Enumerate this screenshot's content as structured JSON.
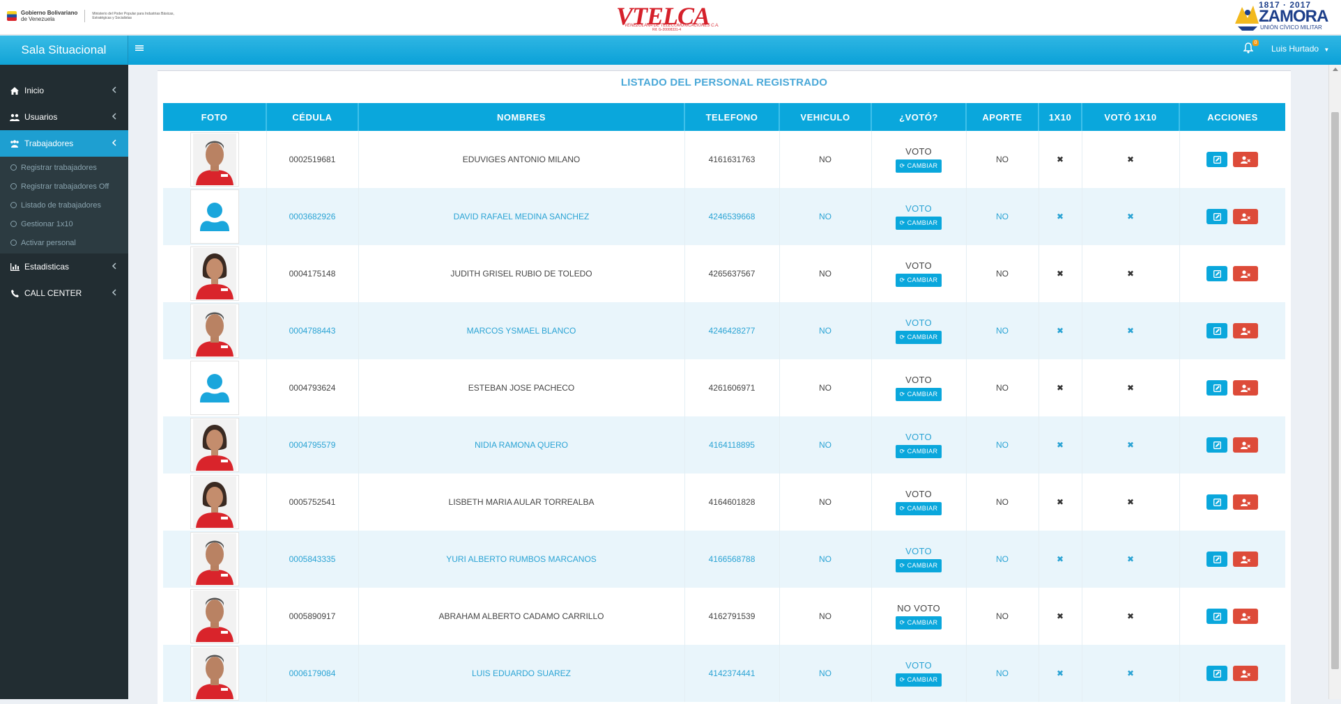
{
  "banner": {
    "gov_line1": "Gobierno Bolivariano",
    "gov_line2": "de Venezuela",
    "gov_ministry": "Ministerio del Poder Popular para Industrias Básicas, Estratégicas y Socialistas",
    "vtelca_mark": "VTELCA",
    "vtelca_sub": "VENEZOLANA DE TELECOMUNICACIONES C.A.",
    "vtelca_rif": "Rif. G-20008331-4",
    "zamora_years": "1817 · 2017",
    "zamora_name": "ZAMORA",
    "zamora_tag": "UNIÓN CÍVICO MILITAR"
  },
  "navbar": {
    "brand": "Sala Situacional",
    "notification_count": "0",
    "user_name": "Luis Hurtado"
  },
  "sidebar": {
    "items": [
      {
        "label": "Inicio",
        "icon": "home-icon"
      },
      {
        "label": "Usuarios",
        "icon": "users-icon"
      },
      {
        "label": "Trabajadores",
        "icon": "workers-icon",
        "active": true
      },
      {
        "label": "Estadisticas",
        "icon": "bar-chart-icon"
      },
      {
        "label": "CALL CENTER",
        "icon": "phone-icon"
      }
    ],
    "submenu": [
      "Registrar trabajadores",
      "Registrar trabajadores Off",
      "Listado de trabajadores",
      "Gestionar 1x10",
      "Activar personal"
    ]
  },
  "main": {
    "title": "LISTADO DEL PERSONAL REGISTRADO",
    "columns": [
      "FOTO",
      "CÉDULA",
      "NOMBRES",
      "TELEFONO",
      "VEHICULO",
      "¿VOTÓ?",
      "APORTE",
      "1X10",
      "VOTÓ 1X10",
      "ACCIONES"
    ],
    "cambiar_label": "CAMBIAR",
    "rows": [
      {
        "photo": "man",
        "cedula": "0002519681",
        "nombres": "EDUVIGES ANTONIO MILANO",
        "telefono": "4161631763",
        "vehiculo": "NO",
        "voto": "VOTO",
        "aporte": "NO"
      },
      {
        "photo": "placeholder",
        "cedula": "0003682926",
        "nombres": "DAVID RAFAEL MEDINA SANCHEZ",
        "telefono": "4246539668",
        "vehiculo": "NO",
        "voto": "VOTO",
        "aporte": "NO"
      },
      {
        "photo": "woman",
        "cedula": "0004175148",
        "nombres": "JUDITH GRISEL RUBIO DE TOLEDO",
        "telefono": "4265637567",
        "vehiculo": "NO",
        "voto": "VOTO",
        "aporte": "NO"
      },
      {
        "photo": "man",
        "cedula": "0004788443",
        "nombres": "MARCOS YSMAEL BLANCO",
        "telefono": "4246428277",
        "vehiculo": "NO",
        "voto": "VOTO",
        "aporte": "NO"
      },
      {
        "photo": "placeholder",
        "cedula": "0004793624",
        "nombres": "ESTEBAN JOSE PACHECO",
        "telefono": "4261606971",
        "vehiculo": "NO",
        "voto": "VOTO",
        "aporte": "NO"
      },
      {
        "photo": "woman",
        "cedula": "0004795579",
        "nombres": "NIDIA RAMONA QUERO",
        "telefono": "4164118895",
        "vehiculo": "NO",
        "voto": "VOTO",
        "aporte": "NO"
      },
      {
        "photo": "woman",
        "cedula": "0005752541",
        "nombres": "LISBETH MARIA AULAR TORREALBA",
        "telefono": "4164601828",
        "vehiculo": "NO",
        "voto": "VOTO",
        "aporte": "NO"
      },
      {
        "photo": "man",
        "cedula": "0005843335",
        "nombres": "YURI ALBERTO RUMBOS MARCANOS",
        "telefono": "4166568788",
        "vehiculo": "NO",
        "voto": "VOTO",
        "aporte": "NO"
      },
      {
        "photo": "man",
        "cedula": "0005890917",
        "nombres": "ABRAHAM ALBERTO CADAMO CARRILLO",
        "telefono": "4162791539",
        "vehiculo": "NO",
        "voto": "NO VOTO",
        "aporte": "NO"
      },
      {
        "photo": "man",
        "cedula": "0006179084",
        "nombres": "LUIS EDUARDO SUAREZ",
        "telefono": "4142374441",
        "vehiculo": "NO",
        "voto": "VOTO",
        "aporte": "NO"
      }
    ]
  },
  "colors": {
    "accent": "#0aa7dc",
    "sidebar_bg": "#222d32",
    "danger": "#dd4b39",
    "row_alt": "#e9f5fb"
  }
}
